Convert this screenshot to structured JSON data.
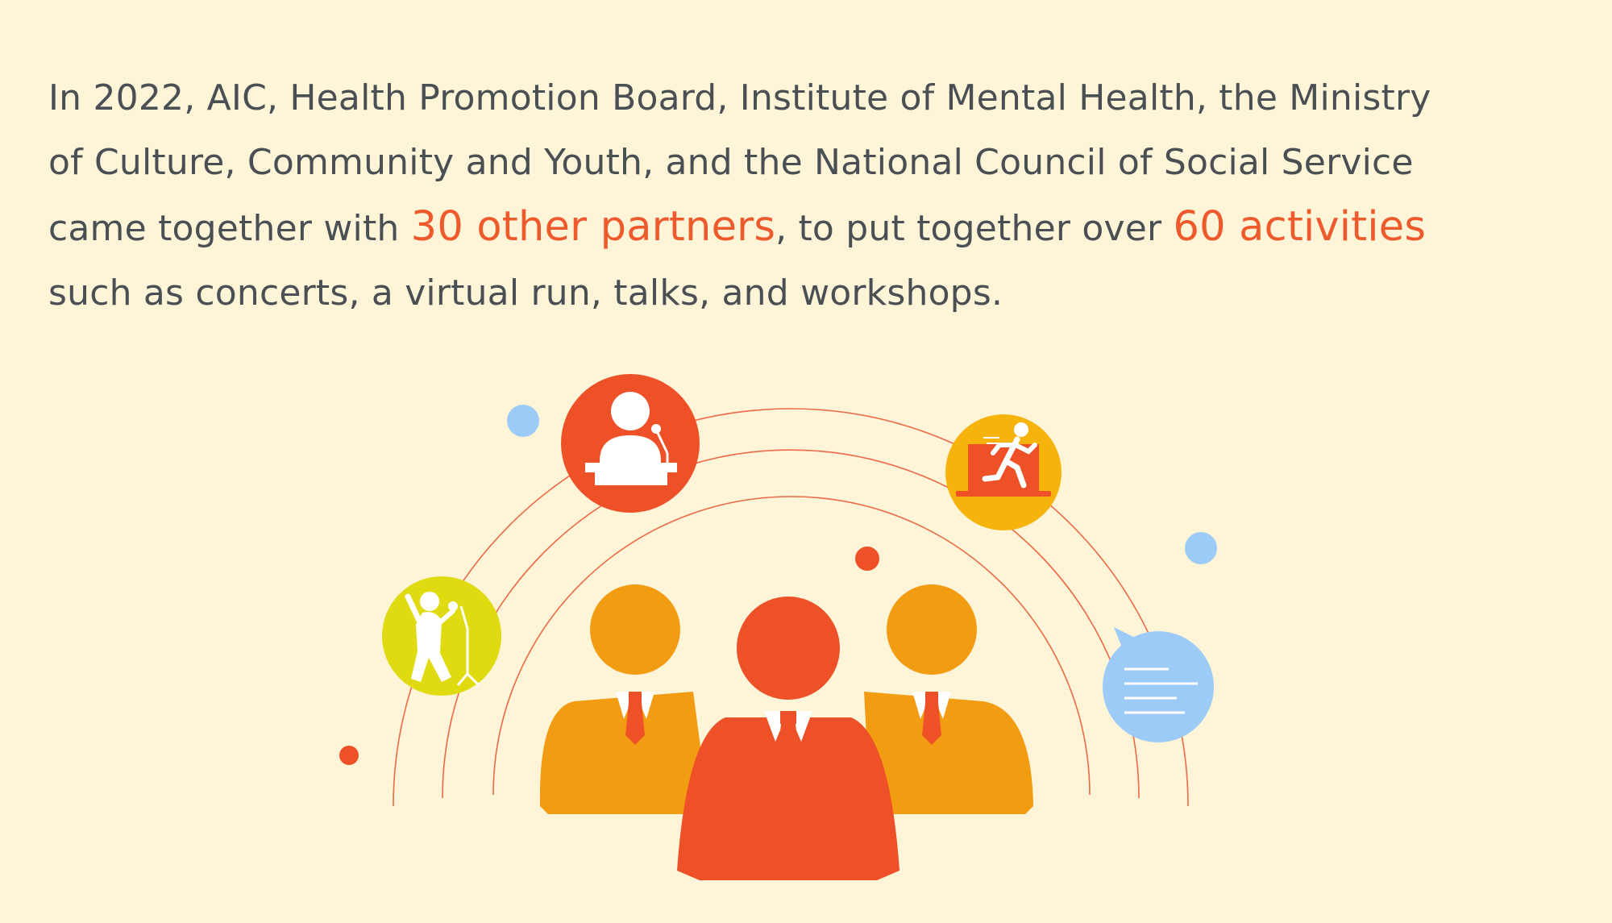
{
  "intro": {
    "line1": "In 2022, AIC, Health Promotion Board, Institute of Mental Health, the Ministry",
    "line2": "of Culture, Community and Youth, and the National Council of Social Service",
    "line3_before": "came together with ",
    "highlight_partners": "30 other partners",
    "line3_middle": ", to put together over ",
    "highlight_activities": "60 activities",
    "line4": "such as concerts, a virtual run, talks, and workshops."
  },
  "colors": {
    "background": "#fef4d8",
    "body_text": "#4a4f54",
    "highlight": "#ee5a2b",
    "accent_orange": "#f29c12",
    "accent_red": "#ee5027",
    "accent_yellow": "#f6b30c",
    "accent_lime": "#dfdb10",
    "accent_blue": "#9ccbf7"
  },
  "icons": {
    "people": "team-people-icon",
    "speaker": "speaker-podium-icon",
    "runner": "virtual-run-laptop-icon",
    "singer": "singer-microphone-icon",
    "chat": "chat-bubble-icon"
  }
}
